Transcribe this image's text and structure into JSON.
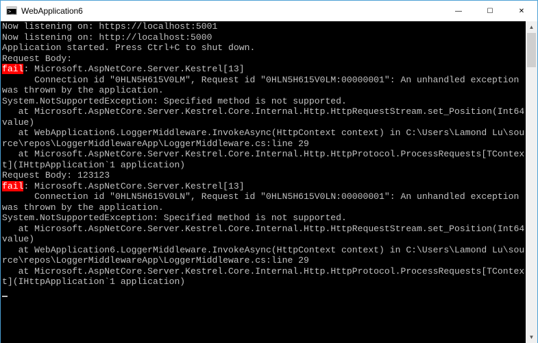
{
  "window": {
    "title": "WebApplication6"
  },
  "controls": {
    "minimize_glyph": "—",
    "maximize_glyph": "☐",
    "close_glyph": "✕"
  },
  "console": {
    "lines": [
      {
        "text": "Now listening on: https://localhost:5001"
      },
      {
        "text": "Now listening on: http://localhost:5000"
      },
      {
        "text": "Application started. Press Ctrl+C to shut down."
      },
      {
        "text": "Request Body:"
      },
      {
        "fail": "fail",
        "text": ": Microsoft.AspNetCore.Server.Kestrel[13]"
      },
      {
        "text": "      Connection id \"0HLN5H615V0LM\", Request id \"0HLN5H615V0LM:00000001\": An unhandled exception was thrown by the application."
      },
      {
        "text": "System.NotSupportedException: Specified method is not supported."
      },
      {
        "text": "   at Microsoft.AspNetCore.Server.Kestrel.Core.Internal.Http.HttpRequestStream.set_Position(Int64 value)"
      },
      {
        "text": "   at WebApplication6.LoggerMiddleware.InvokeAsync(HttpContext context) in C:\\Users\\Lamond Lu\\source\\repos\\LoggerMiddlewareApp\\LoggerMiddleware.cs:line 29"
      },
      {
        "text": "   at Microsoft.AspNetCore.Server.Kestrel.Core.Internal.Http.HttpProtocol.ProcessRequests[TContext](IHttpApplication`1 application)"
      },
      {
        "text": "Request Body: 123123"
      },
      {
        "fail": "fail",
        "text": ": Microsoft.AspNetCore.Server.Kestrel[13]"
      },
      {
        "text": "      Connection id \"0HLN5H615V0LN\", Request id \"0HLN5H615V0LN:00000001\": An unhandled exception was thrown by the application."
      },
      {
        "text": "System.NotSupportedException: Specified method is not supported."
      },
      {
        "text": "   at Microsoft.AspNetCore.Server.Kestrel.Core.Internal.Http.HttpRequestStream.set_Position(Int64 value)"
      },
      {
        "text": "   at WebApplication6.LoggerMiddleware.InvokeAsync(HttpContext context) in C:\\Users\\Lamond Lu\\source\\repos\\LoggerMiddlewareApp\\LoggerMiddleware.cs:line 29"
      },
      {
        "text": "   at Microsoft.AspNetCore.Server.Kestrel.Core.Internal.Http.HttpProtocol.ProcessRequests[TContext](IHttpApplication`1 application)"
      }
    ]
  },
  "scrollbar": {
    "up_glyph": "▲",
    "down_glyph": "▼"
  }
}
